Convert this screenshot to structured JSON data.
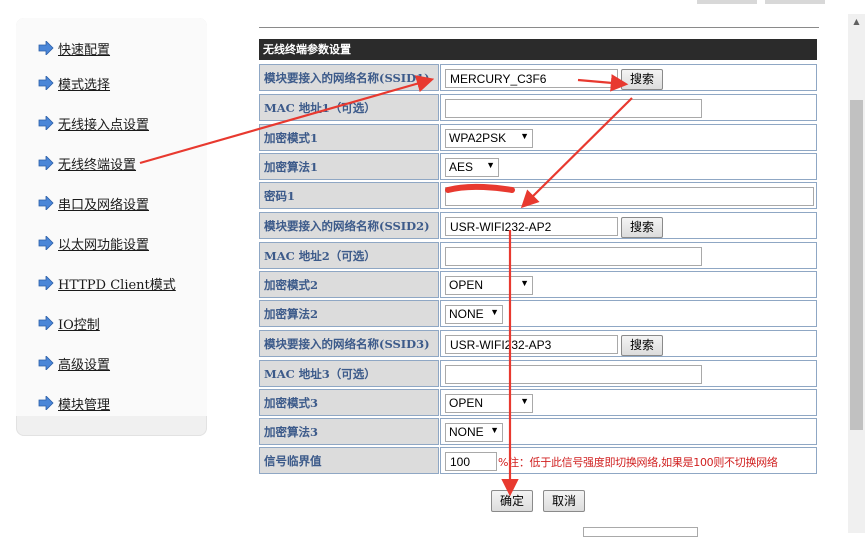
{
  "sidebar": {
    "items": [
      {
        "label": "快速配置"
      },
      {
        "label": "模式选择"
      },
      {
        "label": "无线接入点设置"
      },
      {
        "label": "无线终端设置"
      },
      {
        "label": "串口及网络设置"
      },
      {
        "label": "以太网功能设置"
      },
      {
        "label": "HTTPD Client模式"
      },
      {
        "label": "IO控制"
      },
      {
        "label": "高级设置"
      },
      {
        "label": "模块管理"
      }
    ]
  },
  "form": {
    "title": "无线终端参数设置",
    "ssid1_label": "模块要接入的网络名称(SSID1)",
    "ssid1_value": "MERCURY_C3F6",
    "search_label": "搜索",
    "mac1_label": "MAC 地址1（可选）",
    "mac1_value": "",
    "enc_mode1_label": "加密模式1",
    "enc_mode1_value": "WPA2PSK",
    "enc_alg1_label": "加密算法1",
    "enc_alg1_value": "AES",
    "password1_label": "密码1",
    "password1_value": "",
    "ssid2_label": "模块要接入的网络名称(SSID2)",
    "ssid2_value": "USR-WIFI232-AP2",
    "mac2_label": "MAC 地址2（可选）",
    "mac2_value": "",
    "enc_mode2_label": "加密模式2",
    "enc_mode2_value": "OPEN",
    "enc_alg2_label": "加密算法2",
    "enc_alg2_value": "NONE",
    "ssid3_label": "模块要接入的网络名称(SSID3)",
    "ssid3_value": "USR-WIFI232-AP3",
    "mac3_label": "MAC 地址3（可选）",
    "mac3_value": "",
    "enc_mode3_label": "加密模式3",
    "enc_mode3_value": "OPEN",
    "enc_alg3_label": "加密算法3",
    "enc_alg3_value": "NONE",
    "threshold_label": "信号临界值",
    "threshold_value": "100",
    "threshold_note": "%注：低于此信号强度即切换网络,如果是100则不切换网络",
    "confirm_label": "确定",
    "cancel_label": "取消"
  },
  "colors": {
    "annotation_arrow": "#e8392f",
    "label_text": "#3c5a8a",
    "header_bg": "#2b2b2b",
    "note_text": "#d02020"
  },
  "icons": {
    "nav_bullet": "blue-arrow-right-icon"
  }
}
